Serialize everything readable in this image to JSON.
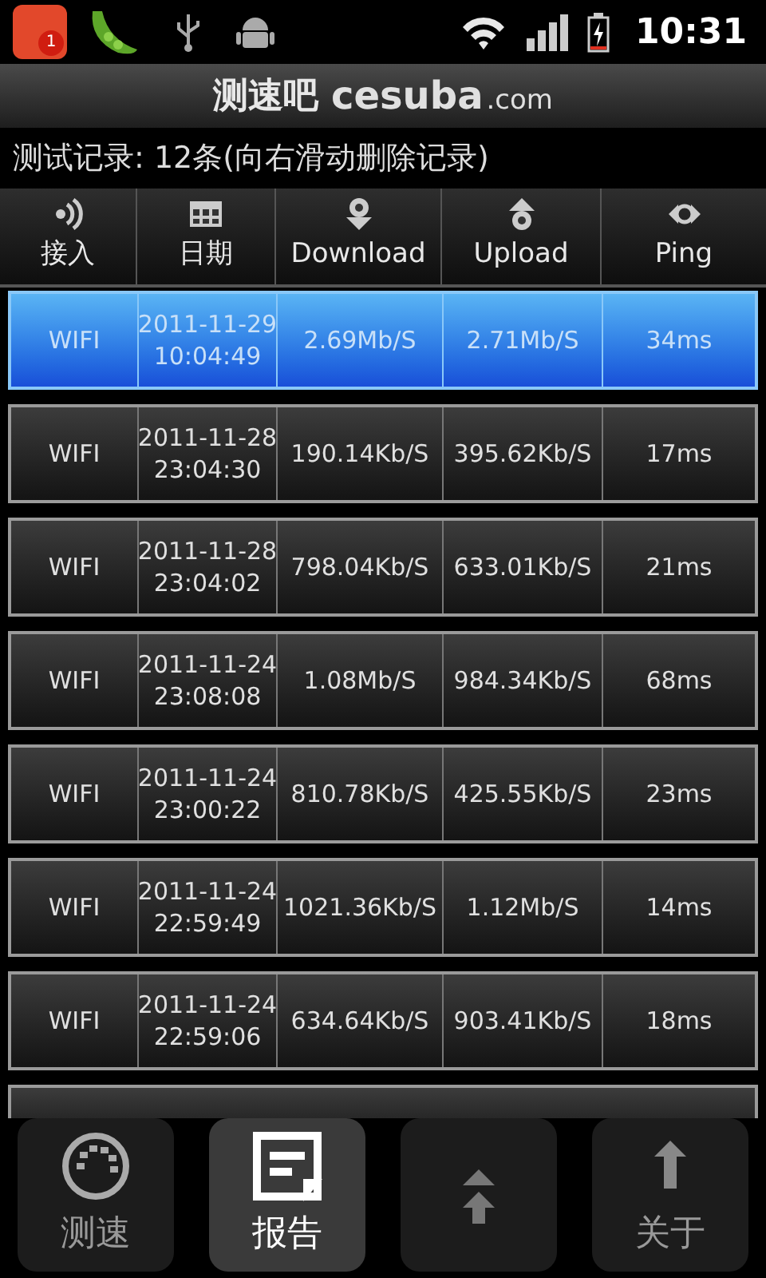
{
  "status_bar": {
    "notification_badge": "1",
    "time": "10:31"
  },
  "title": {
    "brand": "测速吧",
    "domain": "cesuba",
    "tld": ".com"
  },
  "summary": "测试记录: 12条(向右滑动删除记录)",
  "table": {
    "columns": [
      {
        "label": "接入",
        "kind": "signal"
      },
      {
        "label": "日期",
        "kind": "calendar"
      },
      {
        "label": "Download",
        "kind": "download"
      },
      {
        "label": "Upload",
        "kind": "upload"
      },
      {
        "label": "Ping",
        "kind": "ping"
      }
    ],
    "rows": [
      {
        "selected": true,
        "cells": [
          "WIFI",
          "2011-11-29\n10:04:49",
          "2.69Mb/S",
          "2.71Mb/S",
          "34ms"
        ]
      },
      {
        "selected": false,
        "cells": [
          "WIFI",
          "2011-11-28\n23:04:30",
          "190.14Kb/S",
          "395.62Kb/S",
          "17ms"
        ]
      },
      {
        "selected": false,
        "cells": [
          "WIFI",
          "2011-11-28\n23:04:02",
          "798.04Kb/S",
          "633.01Kb/S",
          "21ms"
        ]
      },
      {
        "selected": false,
        "cells": [
          "WIFI",
          "2011-11-24\n23:08:08",
          "1.08Mb/S",
          "984.34Kb/S",
          "68ms"
        ]
      },
      {
        "selected": false,
        "cells": [
          "WIFI",
          "2011-11-24\n23:00:22",
          "810.78Kb/S",
          "425.55Kb/S",
          "23ms"
        ]
      },
      {
        "selected": false,
        "cells": [
          "WIFI",
          "2011-11-24\n22:59:49",
          "1021.36Kb/S",
          "1.12Mb/S",
          "14ms"
        ]
      },
      {
        "selected": false,
        "cells": [
          "WIFI",
          "2011-11-24\n22:59:06",
          "634.64Kb/S",
          "903.41Kb/S",
          "18ms"
        ]
      }
    ]
  },
  "tabs": [
    {
      "label": "测速",
      "kind": "gauge",
      "selected": false
    },
    {
      "label": "报告",
      "kind": "report",
      "selected": true
    },
    {
      "kind": "other",
      "selected": false
    },
    {
      "label": "关于",
      "kind": "about",
      "selected": false
    }
  ]
}
